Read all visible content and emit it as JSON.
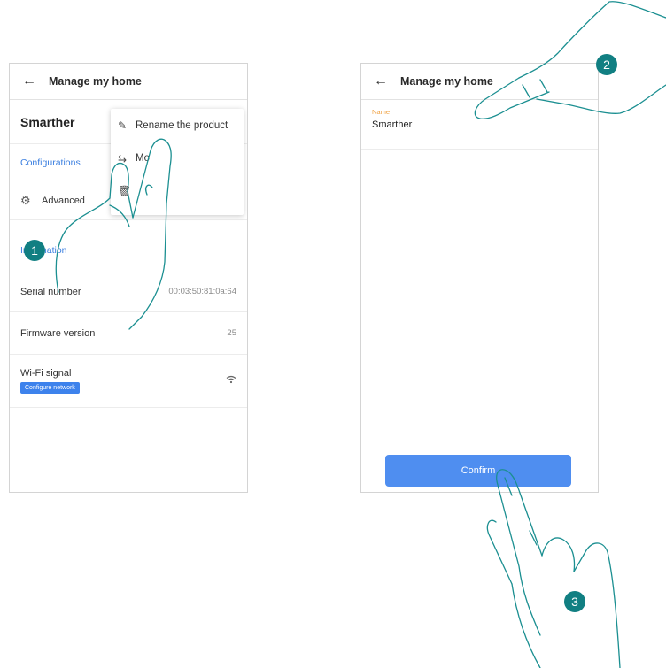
{
  "left_screen": {
    "header": {
      "title": "Manage my home"
    },
    "product_name": "Smarther",
    "sections": {
      "configurations": "Configurations",
      "advanced": "Advanced",
      "information": "Information"
    },
    "info_rows": [
      {
        "label": "Serial number",
        "value": "00:03:50:81:0a:64"
      },
      {
        "label": "Firmware version",
        "value": "25"
      }
    ],
    "wifi": {
      "label": "Wi-Fi signal",
      "badge": "Configure network",
      "icon": "wifi-icon"
    },
    "context_menu": {
      "items": [
        {
          "label": "Rename the product",
          "icon": "pencil-icon"
        },
        {
          "label": "Mo",
          "icon": "swap-icon"
        },
        {
          "label": "",
          "icon": "trash-icon"
        }
      ]
    }
  },
  "right_screen": {
    "header": {
      "title": "Manage my home"
    },
    "name_field": {
      "label": "Name",
      "value": "Smarther"
    },
    "confirm_label": "Confirm"
  },
  "steps": [
    "1",
    "2",
    "3"
  ],
  "colors": {
    "accent_blue": "#3b7fe0",
    "step_teal": "#117f82",
    "field_orange": "#f5a84a",
    "hand_stroke": "#1b8f91"
  }
}
